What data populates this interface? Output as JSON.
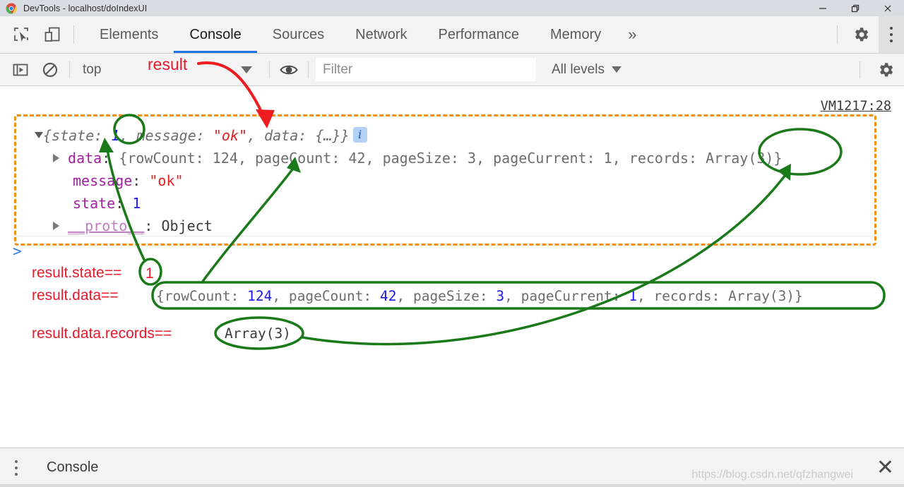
{
  "window": {
    "title": "DevTools - localhost/doIndexUI",
    "logo_icon": "chrome-logo-icon",
    "minimize_label": "Minimize",
    "maximize_label": "Restore",
    "close_label": "Close"
  },
  "toolbar": {
    "inspect_icon": "inspect-element-icon",
    "device_icon": "device-toolbar-icon",
    "tabs": [
      {
        "label": "Elements",
        "active": false
      },
      {
        "label": "Console",
        "active": true
      },
      {
        "label": "Sources",
        "active": false
      },
      {
        "label": "Network",
        "active": false
      },
      {
        "label": "Performance",
        "active": false
      },
      {
        "label": "Memory",
        "active": false
      }
    ],
    "more_tabs_icon": "chevron-double-right-icon",
    "settings_icon": "gear-icon",
    "menu_icon": "kebab-menu-icon"
  },
  "filterbar": {
    "execute_icon": "sidebar-toggle-icon",
    "clear_icon": "clear-console-icon",
    "context_value": "top",
    "eye_icon": "live-expression-eye-icon",
    "filter_placeholder": "Filter",
    "filter_value": "",
    "levels_value": "All levels",
    "settings_icon": "gear-icon"
  },
  "console": {
    "source_link": "VM1217:28",
    "prompt_caret": ">",
    "info_badge": "i",
    "lines": {
      "summary": {
        "prefix": "{state: ",
        "state_value": "1",
        "mid1": ", message: ",
        "message_value": "\"ok\"",
        "mid2": ", data: ",
        "data_value": "{…}",
        "suffix": "}"
      },
      "data_row": {
        "key": "data",
        "colon": ": ",
        "text": "{rowCount: 124, pageCount: 42, pageSize: 3, pageCurrent: 1, records: Array(3)}",
        "rowCount": "124",
        "pageCount": "42",
        "pageSize": "3",
        "pageCurrent": "1",
        "records": "Array(3)"
      },
      "message_row": {
        "key": "message",
        "value": "\"ok\""
      },
      "state_row": {
        "key": "state",
        "value": "1"
      },
      "proto_row": {
        "key": "__proto__",
        "value": "Object"
      }
    }
  },
  "annotations": {
    "result_tag": "result",
    "rows": [
      {
        "label": "result.state==",
        "value": "1"
      },
      {
        "label": "result.data==",
        "value": "{rowCount: 124, pageCount: 42, pageSize: 3, pageCurrent: 1, records: Array(3)}"
      },
      {
        "label": "result.data.records==",
        "value": "Array(3)"
      }
    ],
    "colors": {
      "label_red": "#e8192c",
      "circle_green": "#1a7a1a",
      "dashed_orange": "#f29111",
      "arrow_red": "#ee1b20"
    }
  },
  "drawer": {
    "menu_icon": "kebab-menu-icon",
    "tab_label": "Console",
    "close_icon": "close-icon",
    "watermark": "https://blog.csdn.net/qfzhangwei"
  }
}
